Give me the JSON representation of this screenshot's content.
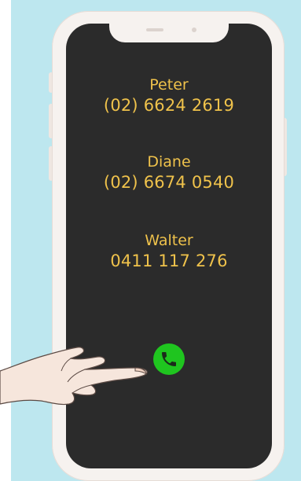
{
  "contacts": [
    {
      "name": "Peter",
      "number": "(02) 6624 2619"
    },
    {
      "name": "Diane",
      "number": "(02) 6674 0540"
    },
    {
      "name": "Walter",
      "number": "0411 117 276"
    }
  ],
  "call_button": {
    "icon": "phone-icon",
    "color": "#1fc51f"
  },
  "colors": {
    "backdrop": "#bde7ef",
    "screen": "#2b2b2b",
    "text": "#efc24b",
    "phone_frame": "#f6f2ef"
  }
}
